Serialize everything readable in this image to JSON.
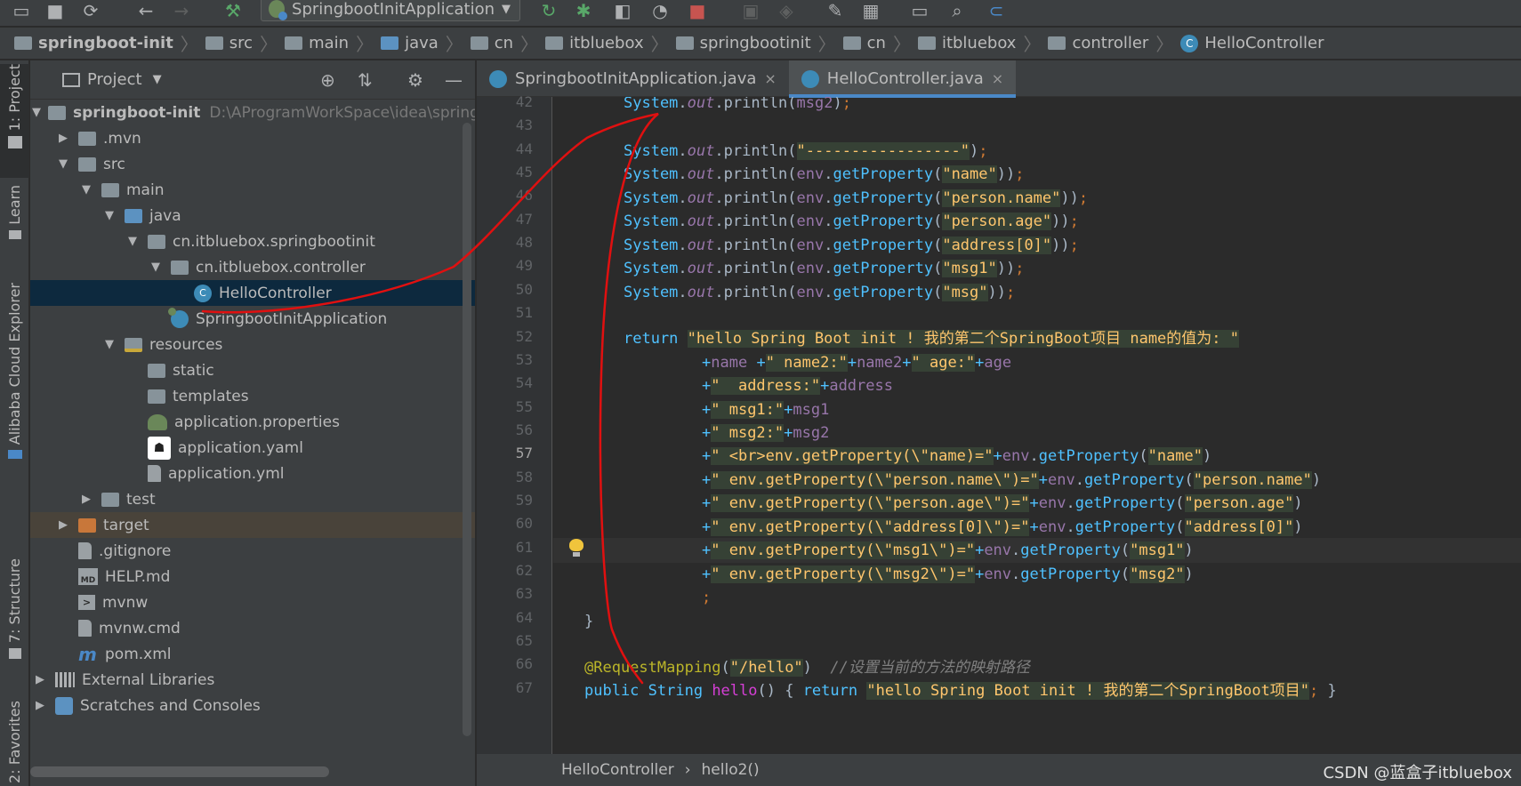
{
  "toolbar": {
    "run_config": "SpringbootInitApplication",
    "icons": [
      "folder-open-icon",
      "save-icon",
      "sync-icon",
      "back-icon",
      "forward-icon",
      "build-hammer-icon",
      "rerun-icon",
      "debug-bug-icon",
      "coverage-icon",
      "profile-icon",
      "stop-icon",
      "gear-icon",
      "wrench-icon",
      "project-structure-icon",
      "terminal-icon",
      "search-icon",
      "collab-icon"
    ]
  },
  "navbar": {
    "crumbs": [
      "springboot-init",
      "src",
      "main",
      "java",
      "cn",
      "itbluebox",
      "springbootinit",
      "cn",
      "itbluebox",
      "controller",
      "HelloController"
    ]
  },
  "left_strip": {
    "project": "1: Project",
    "learn": "Learn",
    "alibaba": "Alibaba Cloud Explorer",
    "structure": "7: Structure",
    "favorites": "2: Favorites"
  },
  "project_panel": {
    "title": "Project",
    "tree": [
      {
        "label": "springboot-init",
        "path": "D:\\AProgramWorkSpace\\idea\\springb"
      },
      {
        "label": ".mvn"
      },
      {
        "label": "src"
      },
      {
        "label": "main"
      },
      {
        "label": "java"
      },
      {
        "label": "cn.itbluebox.springbootinit"
      },
      {
        "label": "cn.itbluebox.controller"
      },
      {
        "label": "HelloController"
      },
      {
        "label": "SpringbootInitApplication"
      },
      {
        "label": "resources"
      },
      {
        "label": "static"
      },
      {
        "label": "templates"
      },
      {
        "label": "application.properties"
      },
      {
        "label": "application.yaml"
      },
      {
        "label": "application.yml"
      },
      {
        "label": "test"
      },
      {
        "label": "target"
      },
      {
        "label": ".gitignore"
      },
      {
        "label": "HELP.md"
      },
      {
        "label": "mvnw"
      },
      {
        "label": "mvnw.cmd"
      },
      {
        "label": "pom.xml"
      },
      {
        "label": "External Libraries"
      },
      {
        "label": "Scratches and Consoles"
      }
    ]
  },
  "editor": {
    "tabs": [
      {
        "label": "SpringbootInitApplication.java",
        "close": "×"
      },
      {
        "label": "HelloController.java",
        "close": "×"
      }
    ],
    "line_numbers": [
      "42",
      "43",
      "44",
      "45",
      "46",
      "47",
      "48",
      "49",
      "50",
      "51",
      "52",
      "53",
      "54",
      "55",
      "56",
      "57",
      "58",
      "59",
      "60",
      "61",
      "62",
      "63",
      "64",
      "65",
      "66",
      "67"
    ],
    "current_line": "57"
  },
  "status": {
    "crumb1": "HelloController",
    "sep": "›",
    "crumb2": "hello2()",
    "watermark": "CSDN @蓝盒子itbluebox"
  },
  "colors": {
    "annotation_stroke": "#e01010",
    "accent": "#4a88c7"
  }
}
